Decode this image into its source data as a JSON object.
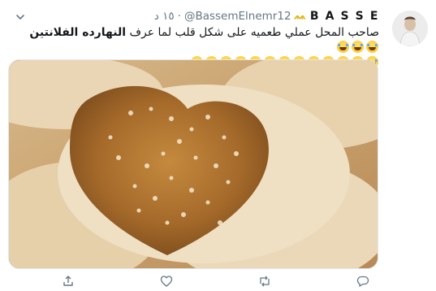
{
  "tweet": {
    "display_name": "B A S S E",
    "name_badge": "ᨐ",
    "handle": "@BassemElnemr12",
    "dot": "·",
    "time": "١٥ د",
    "text_before": "صاحب المحل عملي طعميه على شكل قلب لما عرف ",
    "text_bold": "النهارده الفلانتين",
    "laugh_count_line1": 3,
    "laugh_count_line2": 13
  },
  "actions": {
    "reply_count": "",
    "retweet_count": "",
    "like_count": "",
    "share_count": ""
  },
  "colors": {
    "muted": "#657786",
    "border": "#e1e8ed",
    "badge": "#e0b100"
  },
  "icons": [
    "chevron-down-icon",
    "laughing-emoji-icon",
    "reply-icon",
    "retweet-icon",
    "like-icon",
    "share-icon"
  ]
}
